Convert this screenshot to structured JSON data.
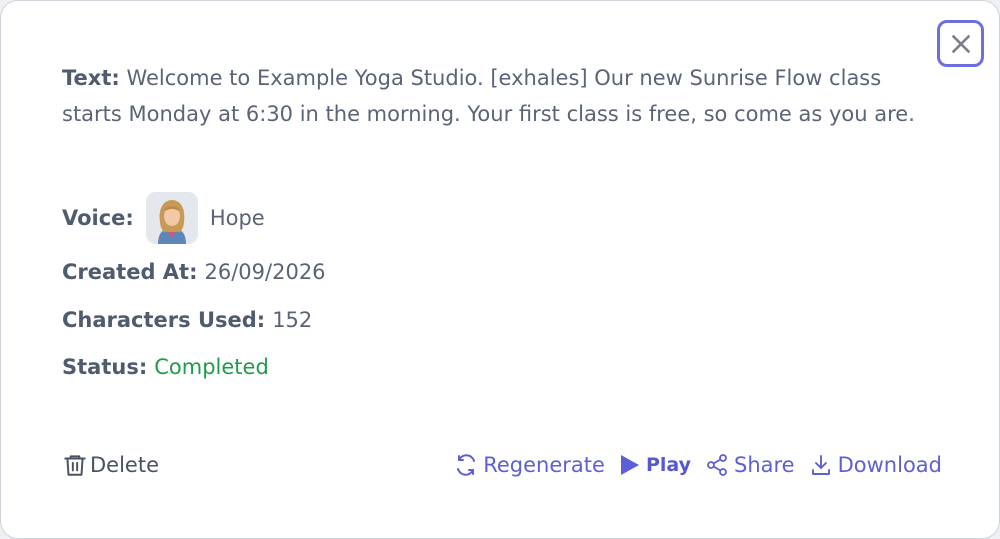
{
  "dialog": {
    "text_label": "Text:",
    "text_value": "Welcome to Example Yoga Studio. [exhales] Our new Sunrise Flow class starts Monday at 6:30 in the morning. Your first class is free, so come as you are.",
    "voice_label": "Voice:",
    "voice_name": "Hope",
    "created_label": "Created At:",
    "created_value": "26/09/2026",
    "chars_label": "Characters Used:",
    "chars_value": "152",
    "status_label": "Status:",
    "status_value": "Completed"
  },
  "actions": {
    "delete_label": "Delete",
    "regenerate_label": "Regenerate",
    "play_label": "Play",
    "share_label": "Share",
    "download_label": "Download"
  },
  "icons": {
    "close": "close-icon",
    "trash": "trash-icon",
    "regenerate": "refresh-icon",
    "play": "play-icon",
    "share": "share-icon",
    "download": "download-icon"
  },
  "colors": {
    "accent": "#5d5fd6",
    "status_completed": "#1e9c4a",
    "text": "#5a6476",
    "close_border": "#6c6fe0"
  }
}
